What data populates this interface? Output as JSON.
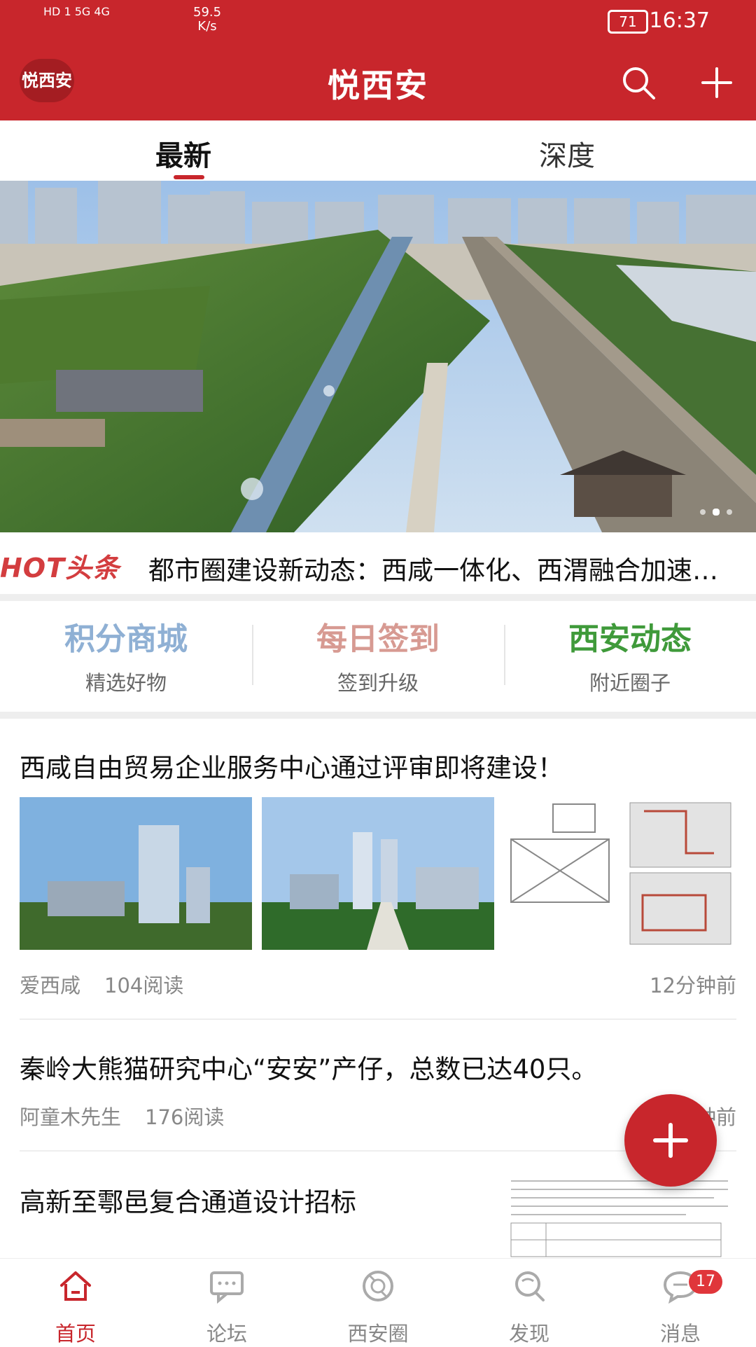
{
  "status_bar": {
    "left": "HD 1 5G 4G",
    "speed": "59.5\nK/s",
    "battery": "71",
    "time": "16:37"
  },
  "header": {
    "logo_text": "悦西安",
    "title": "悦西安",
    "brand_color": "#c8262c"
  },
  "tabs": [
    {
      "label": "最新",
      "active": true
    },
    {
      "label": "深度",
      "active": false
    }
  ],
  "banner": {
    "dots": 3,
    "active_dot": 1
  },
  "hot": {
    "badge": "HOT头条",
    "headline": "都市圈建设新动态：西咸一体化、西渭融合加速推进"
  },
  "quick_entries": [
    {
      "title": "积分商城",
      "subtitle": "精选好物",
      "color": "#8fb0d4"
    },
    {
      "title": "每日签到",
      "subtitle": "签到升级",
      "color": "#d79a92"
    },
    {
      "title": "西安动态",
      "subtitle": "附近圈子",
      "color": "#3f9a3a"
    }
  ],
  "feed": [
    {
      "title": "西咸自由贸易企业服务中心通过评审即将建设！",
      "author": "爱西咸",
      "reads": "104阅读",
      "time": "12分钟前"
    },
    {
      "title": "秦岭大熊猫研究中心“安安”产仔，总数已达40只。",
      "author": "阿童木先生",
      "reads": "176阅读",
      "time": "1分钟前"
    },
    {
      "title": "高新至鄠邑复合通道设计招标"
    }
  ],
  "bottom_nav": [
    {
      "label": "首页",
      "icon": "home-icon",
      "active": true
    },
    {
      "label": "论坛",
      "icon": "forum-icon",
      "active": false
    },
    {
      "label": "西安圈",
      "icon": "circle-icon",
      "active": false
    },
    {
      "label": "发现",
      "icon": "discover-icon",
      "active": false
    },
    {
      "label": "消息",
      "icon": "message-icon",
      "active": false,
      "badge": "17"
    }
  ]
}
